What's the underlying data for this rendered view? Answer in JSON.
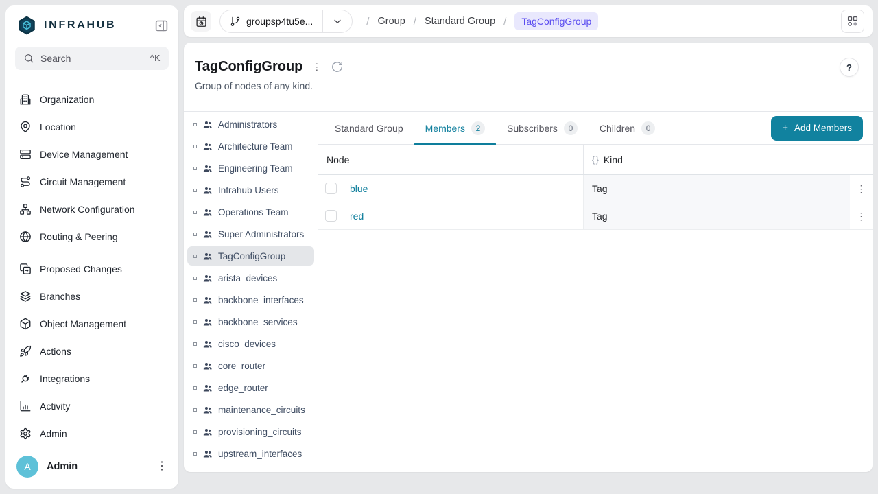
{
  "app": {
    "brand": "INFRAHUB"
  },
  "sidebar": {
    "search": {
      "placeholder": "Search",
      "shortcut": "^K"
    },
    "nav_primary": [
      {
        "label": "Organization",
        "icon": "building-icon"
      },
      {
        "label": "Location",
        "icon": "map-pin-icon"
      },
      {
        "label": "Device Management",
        "icon": "server-icon"
      },
      {
        "label": "Circuit Management",
        "icon": "route-icon"
      },
      {
        "label": "Network Configuration",
        "icon": "network-icon"
      },
      {
        "label": "Routing & Peering",
        "icon": "globe-icon"
      }
    ],
    "nav_secondary": [
      {
        "label": "Proposed Changes",
        "icon": "copy-diff-icon"
      },
      {
        "label": "Branches",
        "icon": "layers-icon"
      },
      {
        "label": "Object Management",
        "icon": "cube-icon"
      },
      {
        "label": "Actions",
        "icon": "rocket-icon"
      },
      {
        "label": "Integrations",
        "icon": "plug-icon"
      },
      {
        "label": "Activity",
        "icon": "bar-chart-icon"
      },
      {
        "label": "Admin",
        "icon": "gear-icon"
      }
    ],
    "user": {
      "name": "Admin",
      "initial": "A"
    }
  },
  "topbar": {
    "branch": "groupsp4tu5e...",
    "separator": "/",
    "breadcrumb": [
      {
        "label": "Group"
      },
      {
        "label": "Standard Group"
      },
      {
        "label": "TagConfigGroup",
        "current": true
      }
    ]
  },
  "page": {
    "title": "TagConfigGroup",
    "description": "Group of nodes of any kind."
  },
  "groups_list": {
    "selected": "TagConfigGroup",
    "items": [
      {
        "label": "Administrators"
      },
      {
        "label": "Architecture Team"
      },
      {
        "label": "Engineering Team"
      },
      {
        "label": "Infrahub Users"
      },
      {
        "label": "Operations Team"
      },
      {
        "label": "Super Administrators"
      },
      {
        "label": "TagConfigGroup"
      },
      {
        "label": "arista_devices"
      },
      {
        "label": "backbone_interfaces"
      },
      {
        "label": "backbone_services"
      },
      {
        "label": "cisco_devices"
      },
      {
        "label": "core_router"
      },
      {
        "label": "edge_router"
      },
      {
        "label": "maintenance_circuits"
      },
      {
        "label": "provisioning_circuits"
      },
      {
        "label": "upstream_interfaces"
      }
    ]
  },
  "tabs": [
    {
      "label": "Standard Group",
      "active": false
    },
    {
      "label": "Members",
      "count": "2",
      "active": true
    },
    {
      "label": "Subscribers",
      "count": "0",
      "active": false
    },
    {
      "label": "Children",
      "count": "0",
      "active": false
    }
  ],
  "actions": {
    "add_members": "Add Members"
  },
  "table": {
    "columns": [
      {
        "label": "Node"
      },
      {
        "label": "Kind"
      }
    ],
    "rows": [
      {
        "node": "blue",
        "kind": "Tag"
      },
      {
        "node": "red",
        "kind": "Tag"
      }
    ]
  },
  "icons": {
    "kebab": "⋮",
    "braces": "{ }",
    "plus": "+",
    "help": "?"
  },
  "colors": {
    "accent": "#0e7e9c",
    "button": "#11829f",
    "chip_bg": "#e9e8fd",
    "chip_text": "#5a4cf0",
    "avatar": "#5ec1d8",
    "page_bg": "#e7e8ea"
  }
}
